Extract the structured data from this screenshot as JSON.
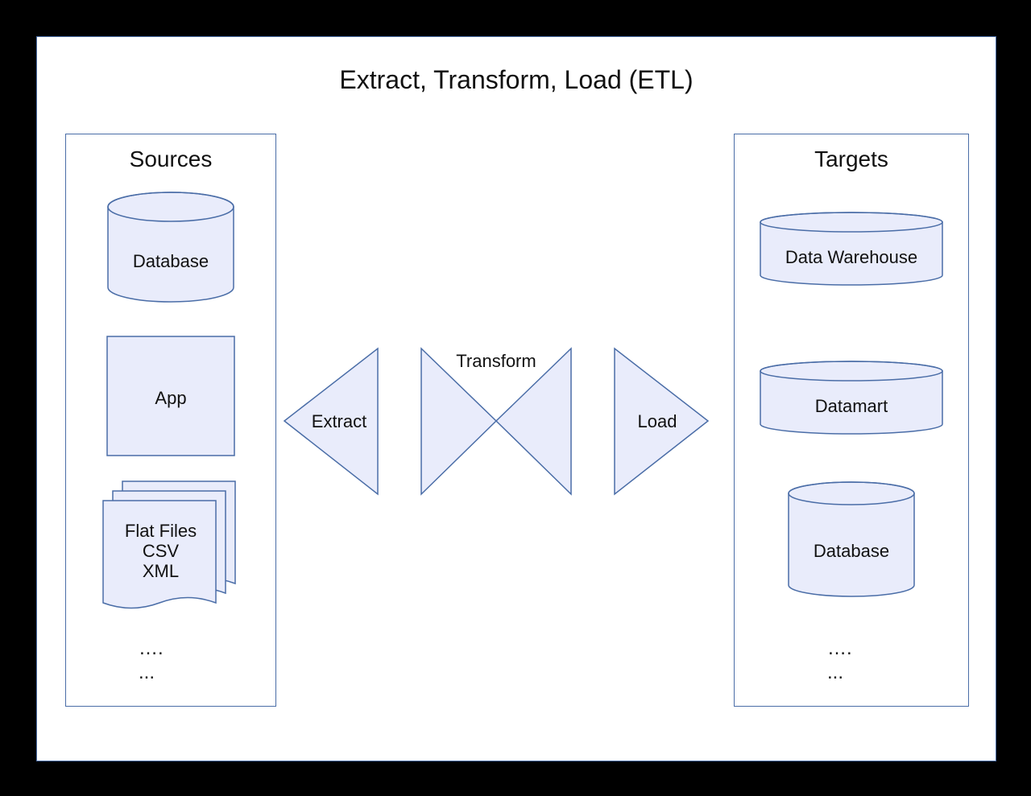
{
  "title": "Extract, Transform, Load (ETL)",
  "sources": {
    "heading": "Sources",
    "database": "Database",
    "app": "App",
    "flatfiles_line1": "Flat Files",
    "flatfiles_line2": "CSV",
    "flatfiles_line3": "XML",
    "ellipsis1": "….",
    "ellipsis2": "..."
  },
  "process": {
    "extract": "Extract",
    "transform": "Transform",
    "load": "Load"
  },
  "targets": {
    "heading": "Targets",
    "datawarehouse": "Data Warehouse",
    "datamart": "Datamart",
    "database": "Database",
    "ellipsis1": "….",
    "ellipsis2": "..."
  },
  "colors": {
    "fill": "#e9ecfb",
    "stroke": "#4a6da7"
  }
}
